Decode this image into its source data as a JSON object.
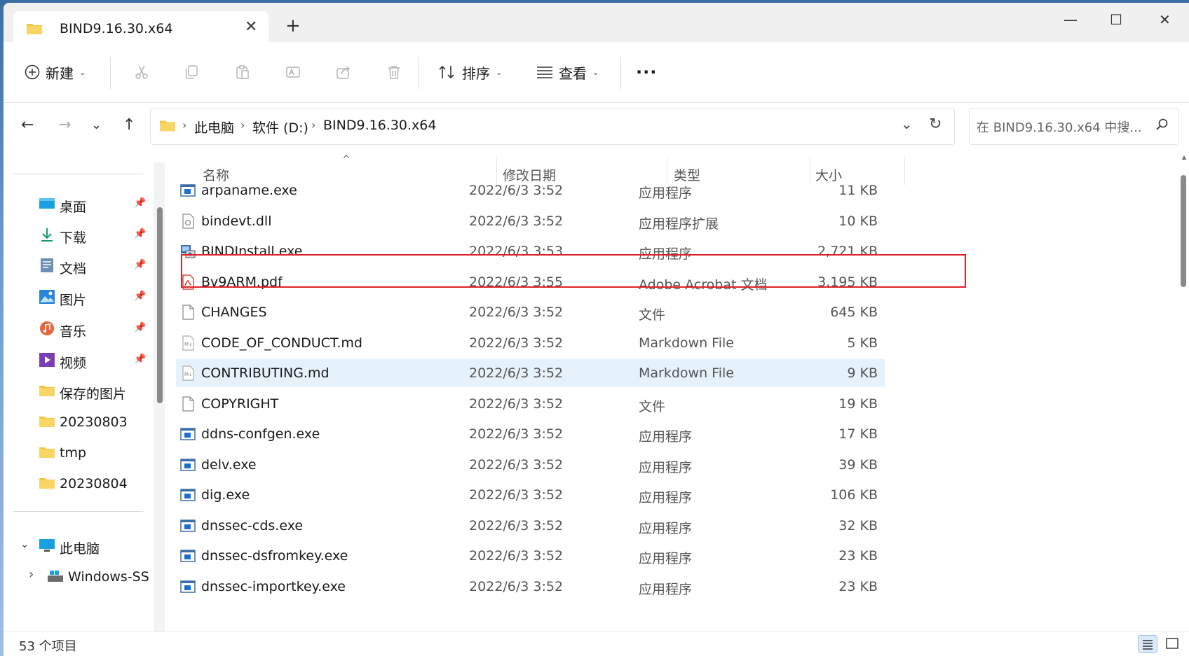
{
  "window": {
    "tab_title": "BIND9.16.30.x64",
    "tab_close": "✕",
    "new_tab": "+",
    "minimize": "—",
    "maximize": "☐",
    "close": "✕"
  },
  "toolbar": {
    "new_label": "新建",
    "sort_label": "排序",
    "view_label": "查看",
    "more_label": "···"
  },
  "address": {
    "crumbs": [
      "此电脑",
      "软件 (D:)",
      "BIND9.16.30.x64"
    ],
    "search_placeholder": "在 BIND9.16.30.x64 中搜..."
  },
  "sidebar": {
    "items": [
      {
        "label": "桌面",
        "icon": "desktop-icon",
        "pinned": true
      },
      {
        "label": "下载",
        "icon": "download-icon",
        "pinned": true
      },
      {
        "label": "文档",
        "icon": "documents-icon",
        "pinned": true
      },
      {
        "label": "图片",
        "icon": "pictures-icon",
        "pinned": true
      },
      {
        "label": "音乐",
        "icon": "music-icon",
        "pinned": true
      },
      {
        "label": "视频",
        "icon": "videos-icon",
        "pinned": true
      },
      {
        "label": "保存的图片",
        "icon": "folder-icon",
        "pinned": false
      },
      {
        "label": "20230803",
        "icon": "folder-icon",
        "pinned": false
      },
      {
        "label": "tmp",
        "icon": "folder-icon",
        "pinned": false
      },
      {
        "label": "20230804",
        "icon": "folder-icon",
        "pinned": false
      }
    ],
    "this_pc": "此电脑",
    "windows_drive": "Windows-SS"
  },
  "columns": {
    "name": "名称",
    "date": "修改日期",
    "type": "类型",
    "size": "大小"
  },
  "files": [
    {
      "name": "arpaname.exe",
      "date": "2022/6/3 3:52",
      "type": "应用程序",
      "size": "11 KB",
      "icon": "exe-icon"
    },
    {
      "name": "bindevt.dll",
      "date": "2022/6/3 3:52",
      "type": "应用程序扩展",
      "size": "10 KB",
      "icon": "dll-icon"
    },
    {
      "name": "BINDInstall.exe",
      "date": "2022/6/3 3:53",
      "type": "应用程序",
      "size": "2,721 KB",
      "icon": "installer-icon"
    },
    {
      "name": "Bv9ARM.pdf",
      "date": "2022/6/3 3:55",
      "type": "Adobe Acrobat 文档",
      "size": "3,195 KB",
      "icon": "pdf-icon"
    },
    {
      "name": "CHANGES",
      "date": "2022/6/3 3:52",
      "type": "文件",
      "size": "645 KB",
      "icon": "file-icon"
    },
    {
      "name": "CODE_OF_CONDUCT.md",
      "date": "2022/6/3 3:52",
      "type": "Markdown File",
      "size": "5 KB",
      "icon": "markdown-icon"
    },
    {
      "name": "CONTRIBUTING.md",
      "date": "2022/6/3 3:52",
      "type": "Markdown File",
      "size": "9 KB",
      "icon": "markdown-icon"
    },
    {
      "name": "COPYRIGHT",
      "date": "2022/6/3 3:52",
      "type": "文件",
      "size": "19 KB",
      "icon": "file-icon"
    },
    {
      "name": "ddns-confgen.exe",
      "date": "2022/6/3 3:52",
      "type": "应用程序",
      "size": "17 KB",
      "icon": "exe-icon"
    },
    {
      "name": "delv.exe",
      "date": "2022/6/3 3:52",
      "type": "应用程序",
      "size": "39 KB",
      "icon": "exe-icon"
    },
    {
      "name": "dig.exe",
      "date": "2022/6/3 3:52",
      "type": "应用程序",
      "size": "106 KB",
      "icon": "exe-icon"
    },
    {
      "name": "dnssec-cds.exe",
      "date": "2022/6/3 3:52",
      "type": "应用程序",
      "size": "32 KB",
      "icon": "exe-icon"
    },
    {
      "name": "dnssec-dsfromkey.exe",
      "date": "2022/6/3 3:52",
      "type": "应用程序",
      "size": "23 KB",
      "icon": "exe-icon"
    },
    {
      "name": "dnssec-importkey.exe",
      "date": "2022/6/3 3:52",
      "type": "应用程序",
      "size": "23 KB",
      "icon": "exe-icon"
    }
  ],
  "status": {
    "count": "53 个项目"
  },
  "colors": {
    "highlight": "#e0202a",
    "hover_row": "#e5f1fb",
    "folder": "#f4c542"
  }
}
